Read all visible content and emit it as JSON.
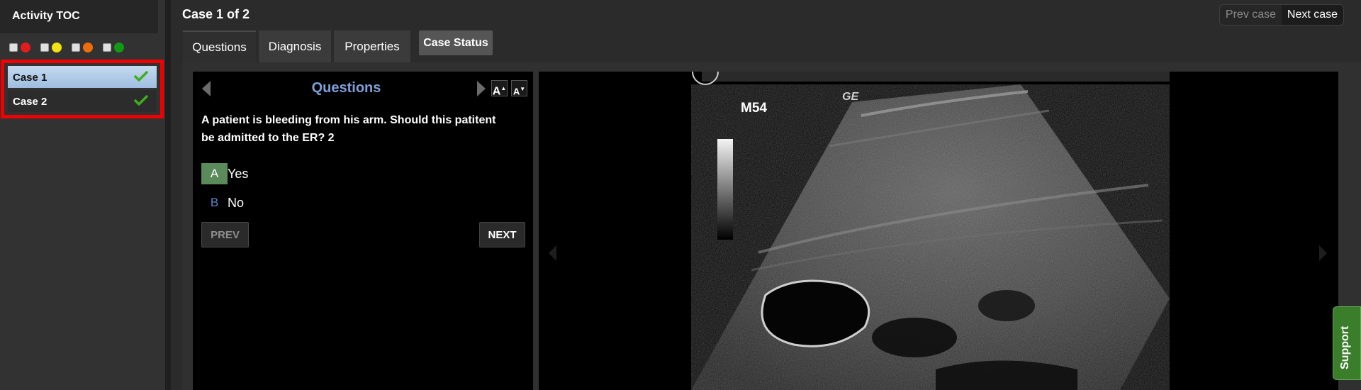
{
  "sidebar": {
    "title": "Activity TOC",
    "filters": [
      {
        "name": "red",
        "color": "#e31c1c"
      },
      {
        "name": "yellow",
        "color": "#f2e20f"
      },
      {
        "name": "orange",
        "color": "#ef6c0c"
      },
      {
        "name": "green",
        "color": "#129a12"
      }
    ],
    "cases": [
      {
        "label": "Case 1",
        "selected": true,
        "completed": true
      },
      {
        "label": "Case 2",
        "selected": false,
        "completed": true
      }
    ]
  },
  "header": {
    "case_title": "Case 1 of 2",
    "prev_case": "Prev case",
    "next_case": "Next case"
  },
  "tabs": [
    {
      "label": "Questions",
      "active": true
    },
    {
      "label": "Diagnosis",
      "active": false
    },
    {
      "label": "Properties",
      "active": false
    }
  ],
  "case_status_label": "Case Status",
  "question_panel": {
    "heading": "Questions",
    "font_increase": "A",
    "font_decrease": "A",
    "question_text": "A patient is bleeding from his arm. Should this patitent be admitted to the ER? 2",
    "options": [
      {
        "letter": "A",
        "text": "Yes",
        "selected": true
      },
      {
        "letter": "B",
        "text": "No",
        "selected": false
      }
    ],
    "prev_label": "PREV",
    "next_label": "NEXT"
  },
  "viewer": {
    "image_label": "M54",
    "logo": "GE"
  },
  "support_label": "Support"
}
